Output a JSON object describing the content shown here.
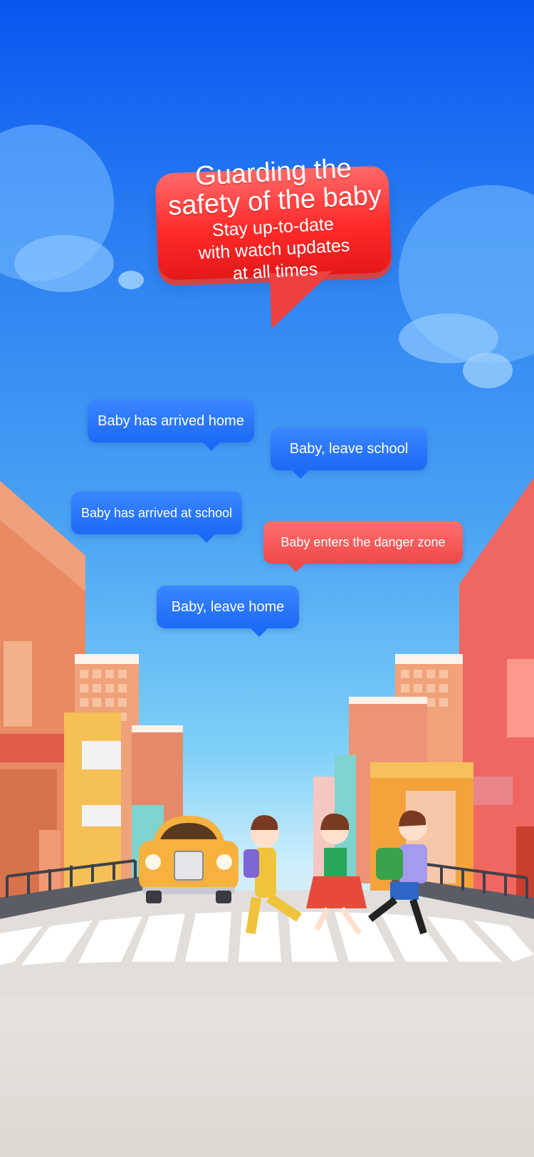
{
  "hero": {
    "title_line1": "Guarding the",
    "title_line2": "safety of the baby",
    "sub_line1": "Stay up-to-date",
    "sub_line2": "with watch updates",
    "sub_line3": "at all times"
  },
  "notifications": [
    {
      "text": "Baby has arrived home",
      "type": "info"
    },
    {
      "text": "Baby, leave school",
      "type": "info"
    },
    {
      "text": "Baby has arrived at school",
      "type": "info"
    },
    {
      "text": "Baby enters the danger zone",
      "type": "alert"
    },
    {
      "text": "Baby, leave home",
      "type": "info"
    }
  ],
  "colors": {
    "sky_top": "#0a55f0",
    "info_bubble": "#1c6af6",
    "alert_bubble": "#f04848",
    "hero_bubble": "#ff2a2a"
  },
  "illustration": {
    "icons": [
      "car-icon",
      "girl-icon",
      "girl-icon",
      "boy-icon",
      "building-icon"
    ]
  }
}
